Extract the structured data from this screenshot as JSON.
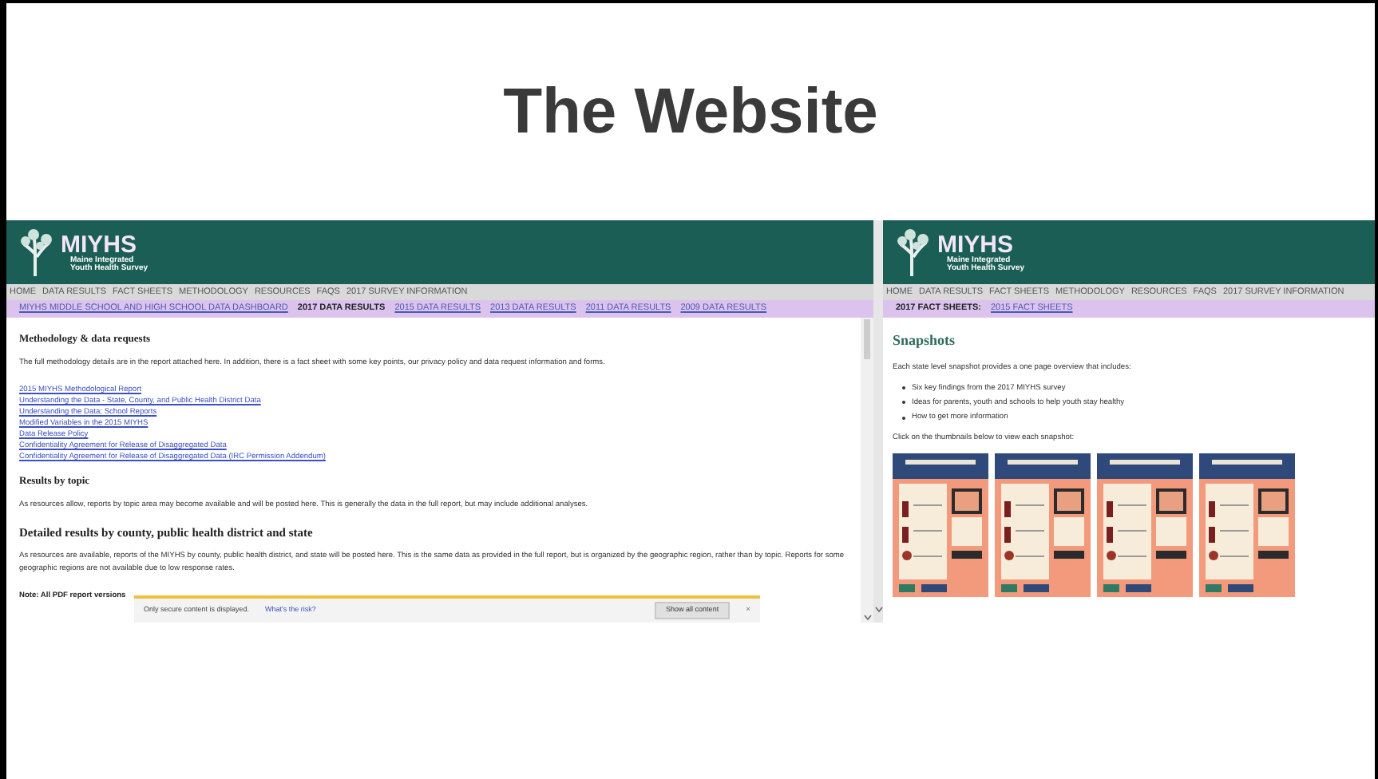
{
  "title": "The Website",
  "data_page": {
    "logo": {
      "name": "MIYHS",
      "subtitle_lines": [
        "Maine Integrated",
        "Youth Health Survey"
      ]
    },
    "nav": [
      "HOME",
      "DATA RESULTS",
      "FACT SHEETS",
      "METHODOLOGY",
      "RESOURCES",
      "FAQS",
      "2017 SURVEY INFORMATION"
    ],
    "subnav": [
      {
        "label": "MIYHS MIDDLE SCHOOL AND HIGH SCHOOL DATA DASHBOARD",
        "selected": false
      },
      {
        "label": "2017 DATA RESULTS",
        "selected": true
      },
      {
        "label": "2015 DATA RESULTS",
        "selected": false
      },
      {
        "label": "2013 DATA RESULTS",
        "selected": false
      },
      {
        "label": "2011 DATA RESULTS",
        "selected": false
      },
      {
        "label": "2009 DATA RESULTS",
        "selected": false
      }
    ],
    "sections": [
      {
        "heading": "Methodology & data requests",
        "paragraphs": [
          "The full methodology details are in the report attached here. In addition, there is a fact sheet with some key points, our privacy policy and data request information and forms."
        ],
        "links": [
          "2015 MIYHS Methodological Report",
          "Understanding the Data - State, County, and Public Health District Data",
          "Understanding the Data: School Reports",
          "Modified Variables in the 2015 MIYHS",
          "Data Release Policy",
          "Confidentiality Agreement for Release of Disaggregated Data",
          "Confidentiality Agreement for Release of Disaggregated Data (IRC Permission Addendum)"
        ]
      },
      {
        "heading": "Results by topic",
        "paragraphs": [
          "As resources allow, reports by topic area may become available and will be posted here. This is generally the data in the full report, but may include additional analyses."
        ]
      },
      {
        "heading": "Detailed results by county, public health district and state",
        "paragraphs": [
          "As resources are available, reports of the MIYHS by county, public health district, and state will be posted here. This is the same data as provided in the full report, but is organized by the geographic region, rather than by topic. Reports for some geographic regions are not available due to low response rates."
        ]
      }
    ],
    "note": "Note: All PDF report versions",
    "notification": {
      "message": "Only secure content is displayed.",
      "link": "What's the risk?",
      "button": "Show all content",
      "close": "×"
    }
  },
  "fact_page": {
    "logo": {
      "name": "MIYHS",
      "subtitle_lines": [
        "Maine Integrated",
        "Youth Health Survey"
      ]
    },
    "nav": [
      "HOME",
      "DATA RESULTS",
      "FACT SHEETS",
      "METHODOLOGY",
      "RESOURCES",
      "FAQS",
      "2017 SURVEY INFORMATION"
    ],
    "subnav": [
      {
        "label": "2017 FACT SHEETS:",
        "selected": true
      },
      {
        "label": "2015 FACT SHEETS",
        "selected": false
      }
    ],
    "heading": "Snapshots",
    "intro": "Each state level snapshot provides a one page overview that includes:",
    "bullets": [
      "Six key findings from the 2017 MIYHS survey",
      "Ideas for parents, youth and schools to help youth stay healthy",
      "How to get more information"
    ],
    "instruction": "Click on the thumbnails below to view each snapshot:"
  }
}
